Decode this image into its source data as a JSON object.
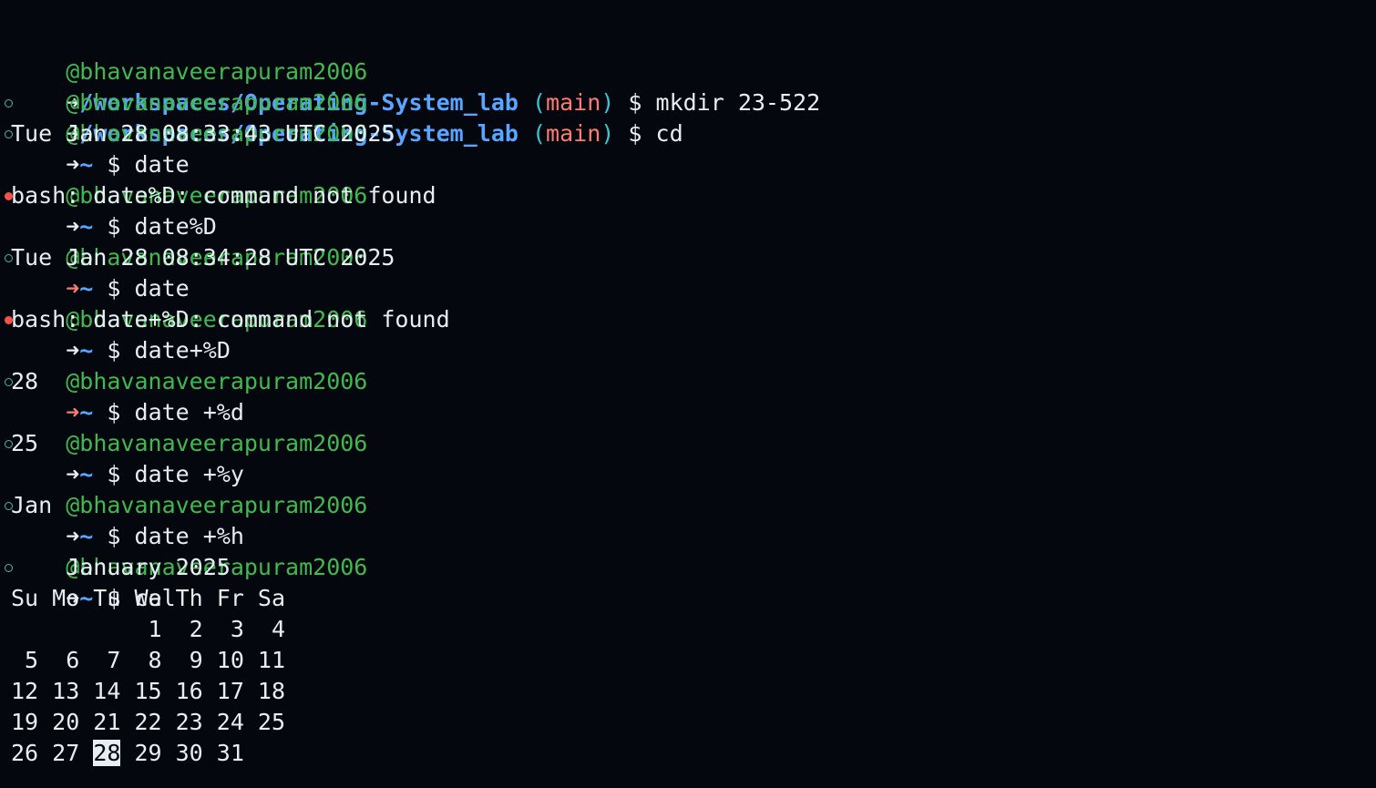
{
  "user": "@bhavanaveerapuram2006",
  "arrow": "➜",
  "prompt_dollar": "$",
  "colors": {
    "background": "#04070d",
    "user": "#3fb950",
    "path": "#58a6ff",
    "branch": "#ff7b72",
    "error_arrow": "#ff7b72",
    "text": "#e6edf3"
  },
  "lines": [
    {
      "type": "prompt",
      "path": "/workspaces/Operating-System_lab",
      "branch": "main",
      "command": "mkdir 23-522",
      "arrow_error": false
    },
    {
      "type": "prompt",
      "path": "/workspaces/Operating-System_lab",
      "branch": "main",
      "command": "cd",
      "arrow_error": false
    },
    {
      "type": "prompt",
      "path": "~",
      "command": "date",
      "arrow_error": false
    },
    {
      "type": "output",
      "text": "Tue Jan 28 08:33:43 UTC 2025"
    },
    {
      "type": "prompt",
      "path": "~",
      "command": "date%D",
      "arrow_error": false
    },
    {
      "type": "output",
      "text": "bash: date%D: command not found"
    },
    {
      "type": "prompt",
      "path": "~",
      "command": "date",
      "arrow_error": true
    },
    {
      "type": "output",
      "text": "Tue Jan 28 08:34:28 UTC 2025"
    },
    {
      "type": "prompt",
      "path": "~",
      "command": "date+%D",
      "arrow_error": false
    },
    {
      "type": "output",
      "text": "bash: date+%D: command not found"
    },
    {
      "type": "prompt",
      "path": "~",
      "command": "date +%d",
      "arrow_error": true
    },
    {
      "type": "output",
      "text": "28"
    },
    {
      "type": "prompt",
      "path": "~",
      "command": "date +%y",
      "arrow_error": false
    },
    {
      "type": "output",
      "text": "25"
    },
    {
      "type": "prompt",
      "path": "~",
      "command": "date +%h",
      "arrow_error": false
    },
    {
      "type": "output",
      "text": "Jan"
    },
    {
      "type": "prompt",
      "path": "~",
      "command": "cal",
      "arrow_error": false
    }
  ],
  "calendar": {
    "title": "    January 2025",
    "header": "Su Mo Tu We Th Fr Sa",
    "rows": [
      "          1  2  3  4",
      " 5  6  7  8  9 10 11",
      "12 13 14 15 16 17 18",
      "19 20 21 22 23 24 25"
    ],
    "last_row_before": "26 27 ",
    "today": "28",
    "last_row_after": " 29 30 31"
  }
}
